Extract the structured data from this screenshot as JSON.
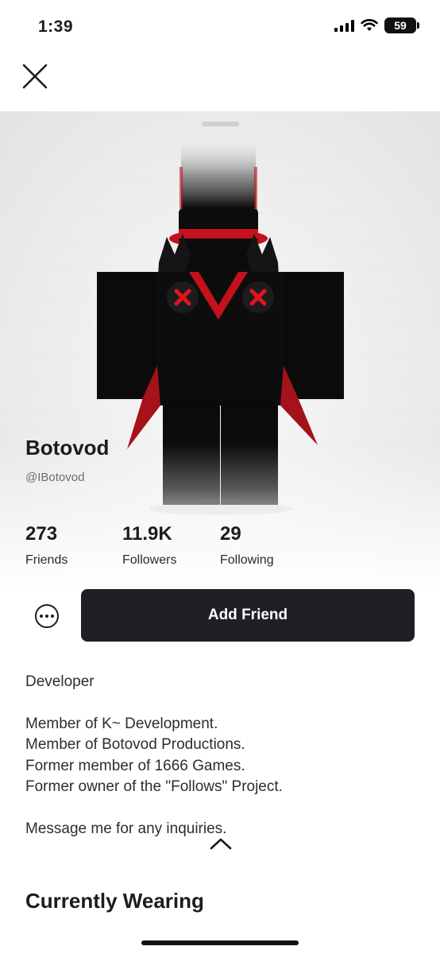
{
  "status_bar": {
    "time": "1:39",
    "battery": "59",
    "icons": [
      "signal-icon",
      "wifi-icon",
      "battery-icon"
    ]
  },
  "top_bar": {
    "close_icon": "close-icon"
  },
  "profile": {
    "display_name": "Botovod",
    "username": "@IBotovod"
  },
  "stats": [
    {
      "value": "273",
      "label": "Friends"
    },
    {
      "value": "11.9K",
      "label": "Followers"
    },
    {
      "value": "29",
      "label": "Following"
    }
  ],
  "actions": {
    "more_icon": "more-options-icon",
    "add_friend_label": "Add Friend"
  },
  "bio": {
    "headline": "Developer",
    "lines": [
      "Member of K~ Development.",
      "Member of Botovod Productions.",
      "Former member of 1666 Games.",
      "Former owner of the \"Follows\" Project."
    ],
    "closing": "Message me for any inquiries."
  },
  "sections": {
    "currently_wearing": "Currently Wearing"
  },
  "colors": {
    "primary_button": "#1f2024",
    "text": "#1b1c20",
    "muted": "#6b6d73",
    "avatar_accent": "#d0101a"
  }
}
